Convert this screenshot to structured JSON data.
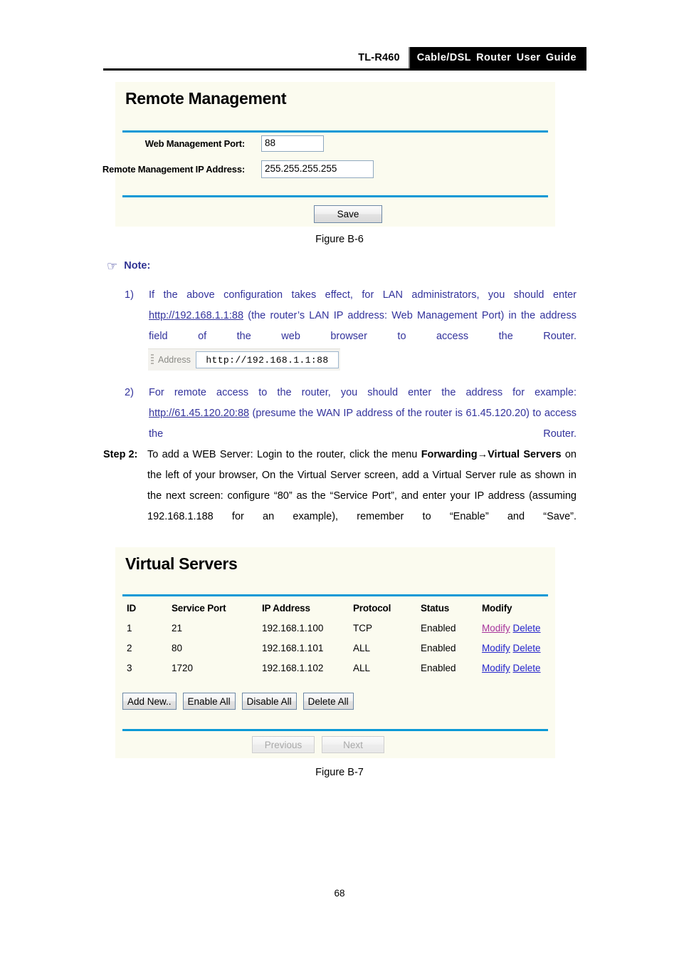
{
  "header": {
    "model": "TL-R460",
    "title": "Cable/DSL  Router  User  Guide"
  },
  "remote_management_panel": {
    "title": "Remote Management",
    "fields": [
      {
        "label": "Web Management Port:",
        "value": "88"
      },
      {
        "label": "Remote Management IP Address:",
        "value": "255.255.255.255"
      }
    ],
    "save_button": "Save"
  },
  "figure_b6_caption": "Figure B-6",
  "note": {
    "icon": "pointing-hand-icon",
    "label": "Note:",
    "items": [
      {
        "number": "1)",
        "text_before_link": "If the above configuration takes effect, for LAN administrators, you should enter ",
        "link": "http://192.168.1.1:88",
        "text_after_link": " (the router’s LAN IP address: Web Management Port) in the address field of the web browser to access the Router."
      },
      {
        "number": "2)",
        "text_before_link": "For remote access to the router, you should enter the address for example: ",
        "link": "http://61.45.120.20:88",
        "text_after_link": " (presume the WAN IP address of the router is 61.45.120.20) to access the Router."
      }
    ]
  },
  "address_bar": {
    "label": "Address",
    "value": "http://192.168.1.1:88"
  },
  "step2": {
    "label": "Step 2:",
    "part1": "To add a WEB Server: Login to the router, click the menu ",
    "bold1": "Forwarding→Virtual Servers",
    "part2": " on the left of your browser, On the Virtual Server screen, add a Virtual Server rule as shown in the next screen: configure “80” as the “Service Port”, and enter your IP address (assuming 192.168.1.188 for an example), remember to “Enable” and “Save”."
  },
  "virtual_servers_panel": {
    "title": "Virtual Servers",
    "columns": [
      "ID",
      "Service Port",
      "IP Address",
      "Protocol",
      "Status",
      "Modify"
    ],
    "rows": [
      {
        "id": "1",
        "service_port": "21",
        "ip_address": "192.168.1.100",
        "protocol": "TCP",
        "status": "Enabled",
        "modify": "Modify",
        "delete": "Delete",
        "modify_visited": true
      },
      {
        "id": "2",
        "service_port": "80",
        "ip_address": "192.168.1.101",
        "protocol": "ALL",
        "status": "Enabled",
        "modify": "Modify",
        "delete": "Delete",
        "modify_visited": false
      },
      {
        "id": "3",
        "service_port": "1720",
        "ip_address": "192.168.1.102",
        "protocol": "ALL",
        "status": "Enabled",
        "modify": "Modify",
        "delete": "Delete",
        "modify_visited": false
      }
    ],
    "buttons": [
      "Add New..",
      "Enable All",
      "Disable All",
      "Delete All"
    ],
    "pager": {
      "previous": "Previous",
      "next": "Next",
      "disabled": true
    }
  },
  "figure_b7_caption": "Figure B-7",
  "page_number": "68",
  "colors": {
    "panel_background": "#fbfbef",
    "accent_rule": "#0b99d6",
    "note_text": "#33339c",
    "link_blue": "#2222cc",
    "link_visited": "#a6329b",
    "header_bar": "#000000"
  }
}
